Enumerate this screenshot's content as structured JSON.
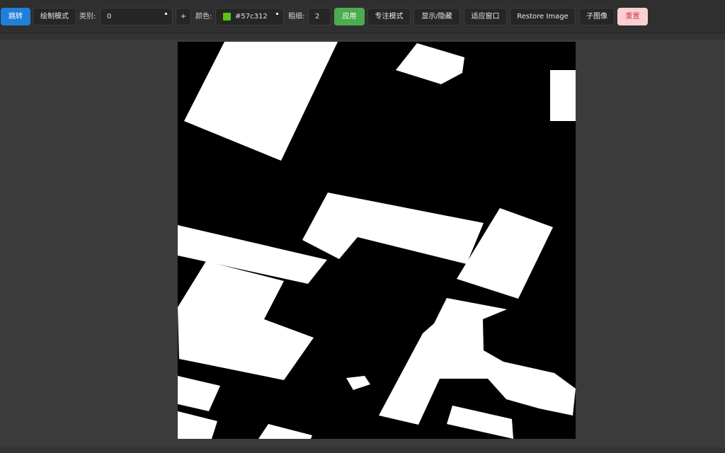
{
  "toolbar": {
    "jump_label": "跳转",
    "draw_mode_label": "绘制模式",
    "category_label": "类别:",
    "category_value": "0",
    "add_label": "+",
    "color_label": "颜色:",
    "color_value": "#57c312",
    "color_swatch": "#57c312",
    "thickness_label": "粗细:",
    "thickness_value": "2",
    "apply_label": "应用",
    "focus_mode_label": "专注模式",
    "toggle_label": "显示/隐藏",
    "fit_window_label": "适应窗口",
    "restore_label": "Restore Image",
    "sub_image_label": "子图像",
    "reset_label": "重置"
  },
  "canvas": {
    "description": "binary segmentation mask",
    "foreground_color": "#ffffff",
    "background_color": "#000000"
  }
}
